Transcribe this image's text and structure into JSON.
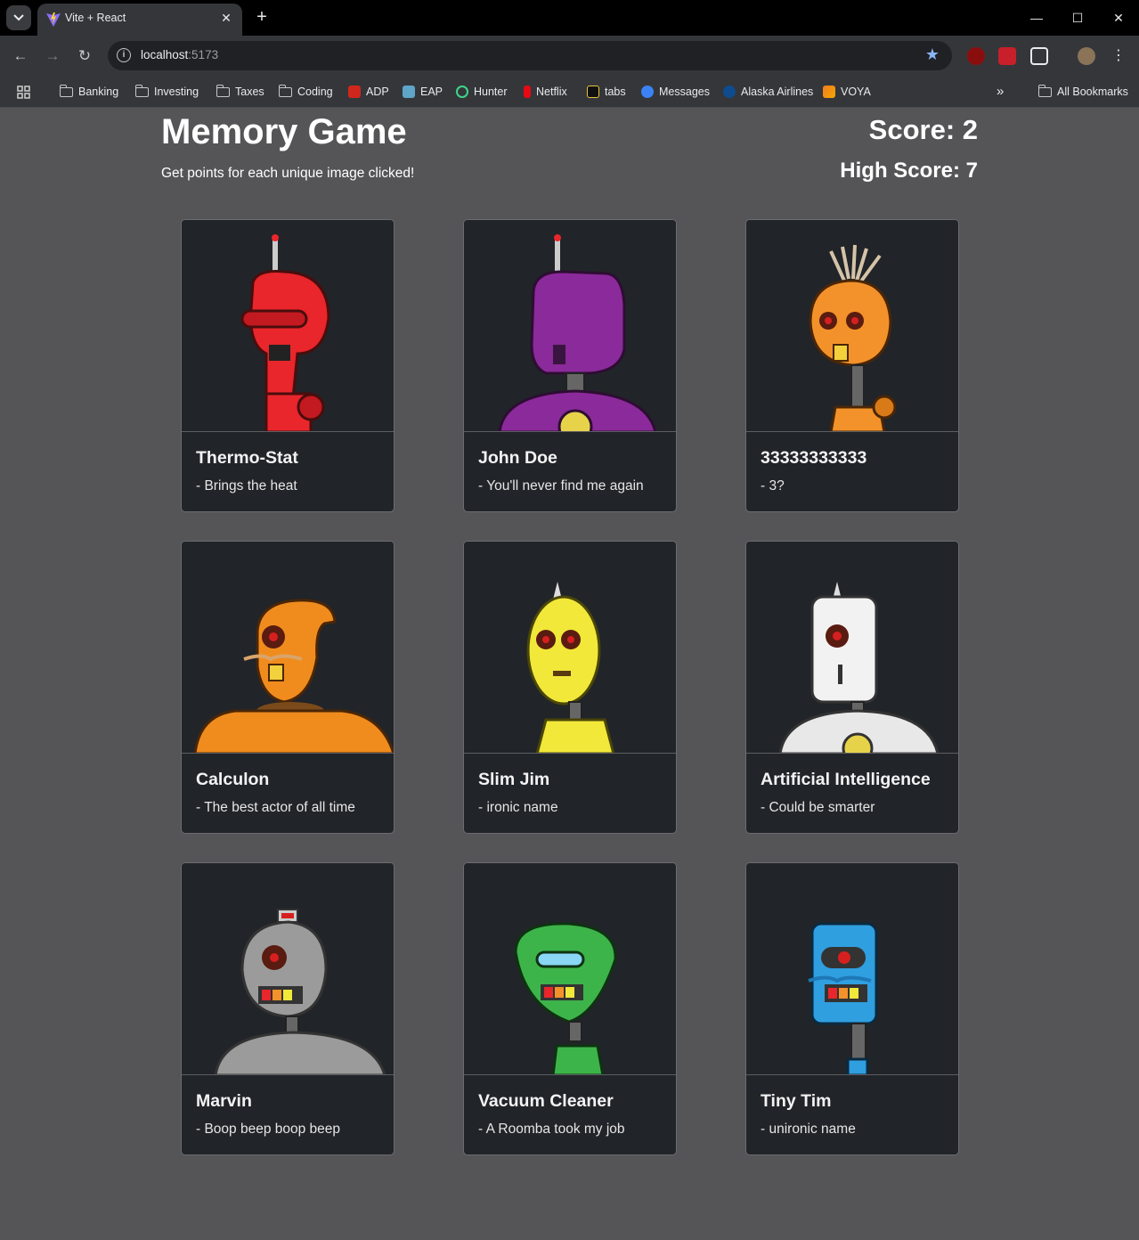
{
  "browser": {
    "tab_title": "Vite + React",
    "url_host": "localhost",
    "url_port": ":5173",
    "bookmarks": [
      "Banking",
      "Investing",
      "Taxes",
      "Coding",
      "ADP",
      "EAP",
      "Hunter",
      "Netflix",
      "tabs",
      "Messages",
      "Alaska Airlines",
      "VOYA"
    ],
    "all_bookmarks": "All Bookmarks",
    "more_glyph": "»"
  },
  "game": {
    "title": "Memory Game",
    "subtitle": "Get points for each unique image clicked!",
    "score": "Score: 2",
    "high_score": "High Score: 7"
  },
  "cards": [
    {
      "name": "Thermo-Stat",
      "desc": "- Brings the heat",
      "color": "#e8262b"
    },
    {
      "name": "John Doe",
      "desc": "- You'll never find me again",
      "color": "#8b2a9a"
    },
    {
      "name": "33333333333",
      "desc": "- 3?",
      "color": "#f3922a"
    },
    {
      "name": "Calculon",
      "desc": "- The best actor of all time",
      "color": "#f08c1e"
    },
    {
      "name": "Slim Jim",
      "desc": "- ironic name",
      "color": "#f1e83a"
    },
    {
      "name": "Artificial Intelligence",
      "desc": "- Could be smarter",
      "color": "#f2f2f2"
    },
    {
      "name": "Marvin",
      "desc": "- Boop beep boop beep",
      "color": "#9b9b9b"
    },
    {
      "name": "Vacuum Cleaner",
      "desc": "- A Roomba took my job",
      "color": "#3db44a"
    },
    {
      "name": "Tiny Tim",
      "desc": "- unironic name",
      "color": "#2f9fe0"
    }
  ]
}
